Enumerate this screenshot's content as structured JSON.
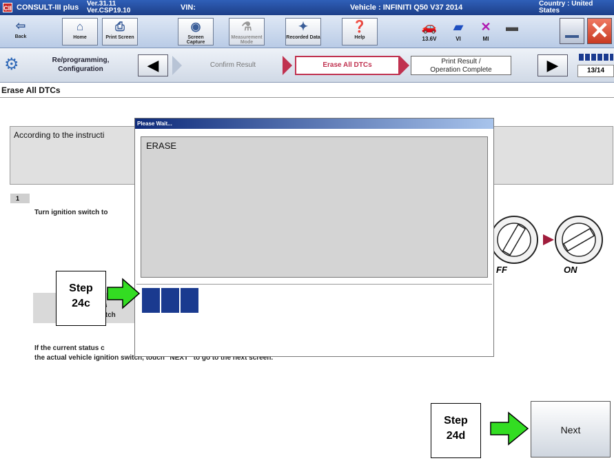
{
  "titlebar": {
    "logo": "CII",
    "app_name": "CONSULT-III plus",
    "version_line1": "Ver.31.11",
    "version_line2": "Ver.CSP19.10",
    "vin_label": "VIN:",
    "vehicle": "Vehicle : INFINITI Q50 V37 2014",
    "country_line1": "Country : United",
    "country_line2": "States"
  },
  "toolbar": {
    "back": "Back",
    "home": "Home",
    "print_screen": "Print Screen",
    "screen_capture": "Screen Capture",
    "measurement_mode": "Measurement Mode",
    "recorded_data": "Recorded Data",
    "help": "Help",
    "voltage": "13.6V",
    "vi": "VI",
    "mi": "MI"
  },
  "process": {
    "title": "Re/programming, Configuration",
    "step_confirm": "Confirm Result",
    "step_erase": "Erase All DTCs",
    "step_print_line1": "Print Result /",
    "step_print_line2": "Operation Complete",
    "pager": "13/14"
  },
  "main": {
    "page_label": "Erase All DTCs",
    "instruction": "According to the instructi",
    "step_number": "1",
    "turn_text": "Turn ignition switch to",
    "current_label_a": "s",
    "current_label_b": "itch",
    "status_line1": "If the current status c",
    "status_line2": "the actual vehicle ignition switch, touch \"NEXT\" to go to the next screen.",
    "off_label": "FF",
    "on_label": "ON",
    "next_button": "Next"
  },
  "dialog": {
    "title": "Please Wait...",
    "message": "ERASE",
    "progress_blocks": 3
  },
  "callouts": {
    "step_24c_line1": "Step",
    "step_24c_line2": "24c",
    "step_24d_line1": "Step",
    "step_24d_line2": "24d"
  },
  "colors": {
    "accent_blue": "#1a3a8f",
    "highlight_red": "#c0314f",
    "arrow_green": "#33dd22"
  }
}
